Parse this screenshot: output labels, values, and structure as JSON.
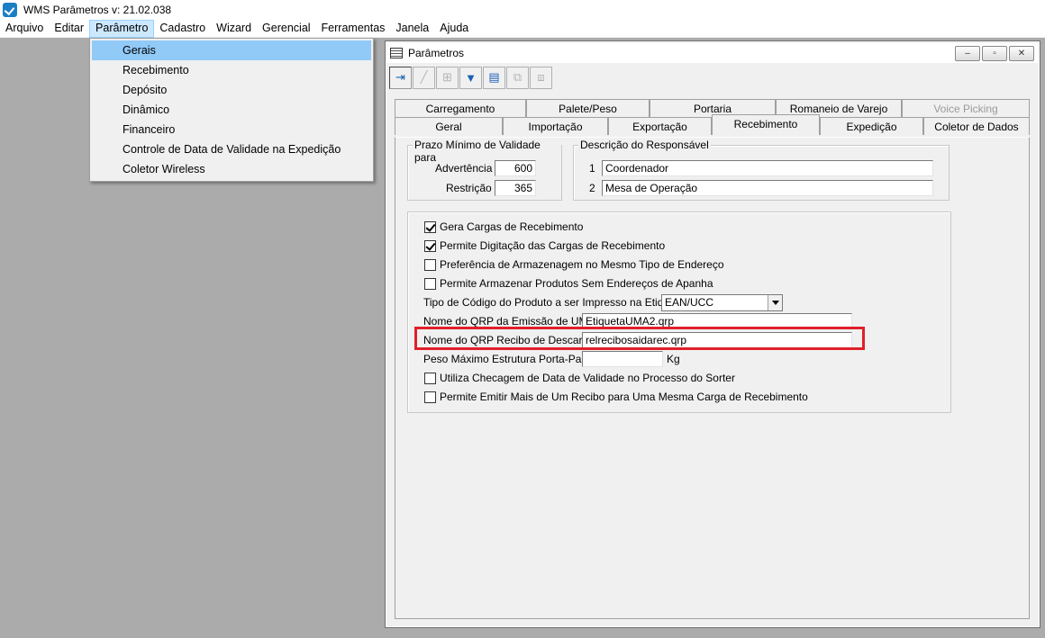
{
  "window": {
    "title": "WMS Parâmetros  v: 21.02.038"
  },
  "menubar": {
    "items": [
      "Arquivo",
      "Editar",
      "Parâmetro",
      "Cadastro",
      "Wizard",
      "Gerencial",
      "Ferramentas",
      "Janela",
      "Ajuda"
    ]
  },
  "dropdown": {
    "items": [
      "Gerais",
      "Recebimento",
      "Depósito",
      "Dinâmico",
      "Financeiro",
      "Controle de Data de Validade na Expedição",
      "Coletor Wireless"
    ]
  },
  "child": {
    "title": "Parâmetros",
    "buttons": {
      "minimize": "‒",
      "restore": "▫",
      "close": "✕"
    }
  },
  "tabs": {
    "row_back": [
      "Carregamento",
      "Palete/Peso",
      "Portaria",
      "Romaneio de Varejo",
      "Voice Picking"
    ],
    "row_front": [
      "Geral",
      "Importação",
      "Exportação",
      "Recebimento",
      "Expedição",
      "Coletor de Dados"
    ]
  },
  "panel": {
    "prazo": {
      "title": "Prazo Mínimo de Validade para",
      "advertencia_label": "Advertência",
      "advertencia_value": "600",
      "restricao_label": "Restrição",
      "restricao_value": "365"
    },
    "responsavel": {
      "title": "Descrição do Responsável",
      "n1": "1",
      "v1": "Coordenador",
      "n2": "2",
      "v2": "Mesa de Operação"
    },
    "options": {
      "gera_cargas": "Gera Cargas de Recebimento",
      "permite_digitacao": "Permite Digitação das Cargas de Recebimento",
      "preferencia": "Preferência de Armazenagem no Mesmo Tipo de Endereço",
      "permite_armazenar": "Permite Armazenar Produtos Sem Endereços de Apanha",
      "tipo_codigo_label": "Tipo de Código do Produto a ser Impresso na Etiqueta",
      "tipo_codigo_value": "EAN/UCC",
      "qrp_uma_label": "Nome do QRP da Emissão de UMA",
      "qrp_uma_value": "EtiquetaUMA2.qrp",
      "qrp_recibo_label": "Nome do QRP Recibo de Descarga",
      "qrp_recibo_value": "relrecibosaidarec.qrp",
      "peso_label": "Peso Máximo Estrutura Porta-Palete",
      "peso_value": "",
      "peso_unit": "Kg",
      "utiliza_checagem": "Utiliza Checagem de Data de Validade no Processo do Sorter",
      "permite_emitir": "Permite Emitir Mais de Um Recibo para Uma Mesma Carga de Recebimento"
    },
    "checked": {
      "gera_cargas": true,
      "permite_digitacao": true,
      "preferencia": false,
      "permite_armazenar": false,
      "utiliza_checagem": false,
      "permite_emitir": false
    }
  },
  "colors": {
    "highlight": "#e0202a",
    "menu_selected": "#91c9f7"
  }
}
